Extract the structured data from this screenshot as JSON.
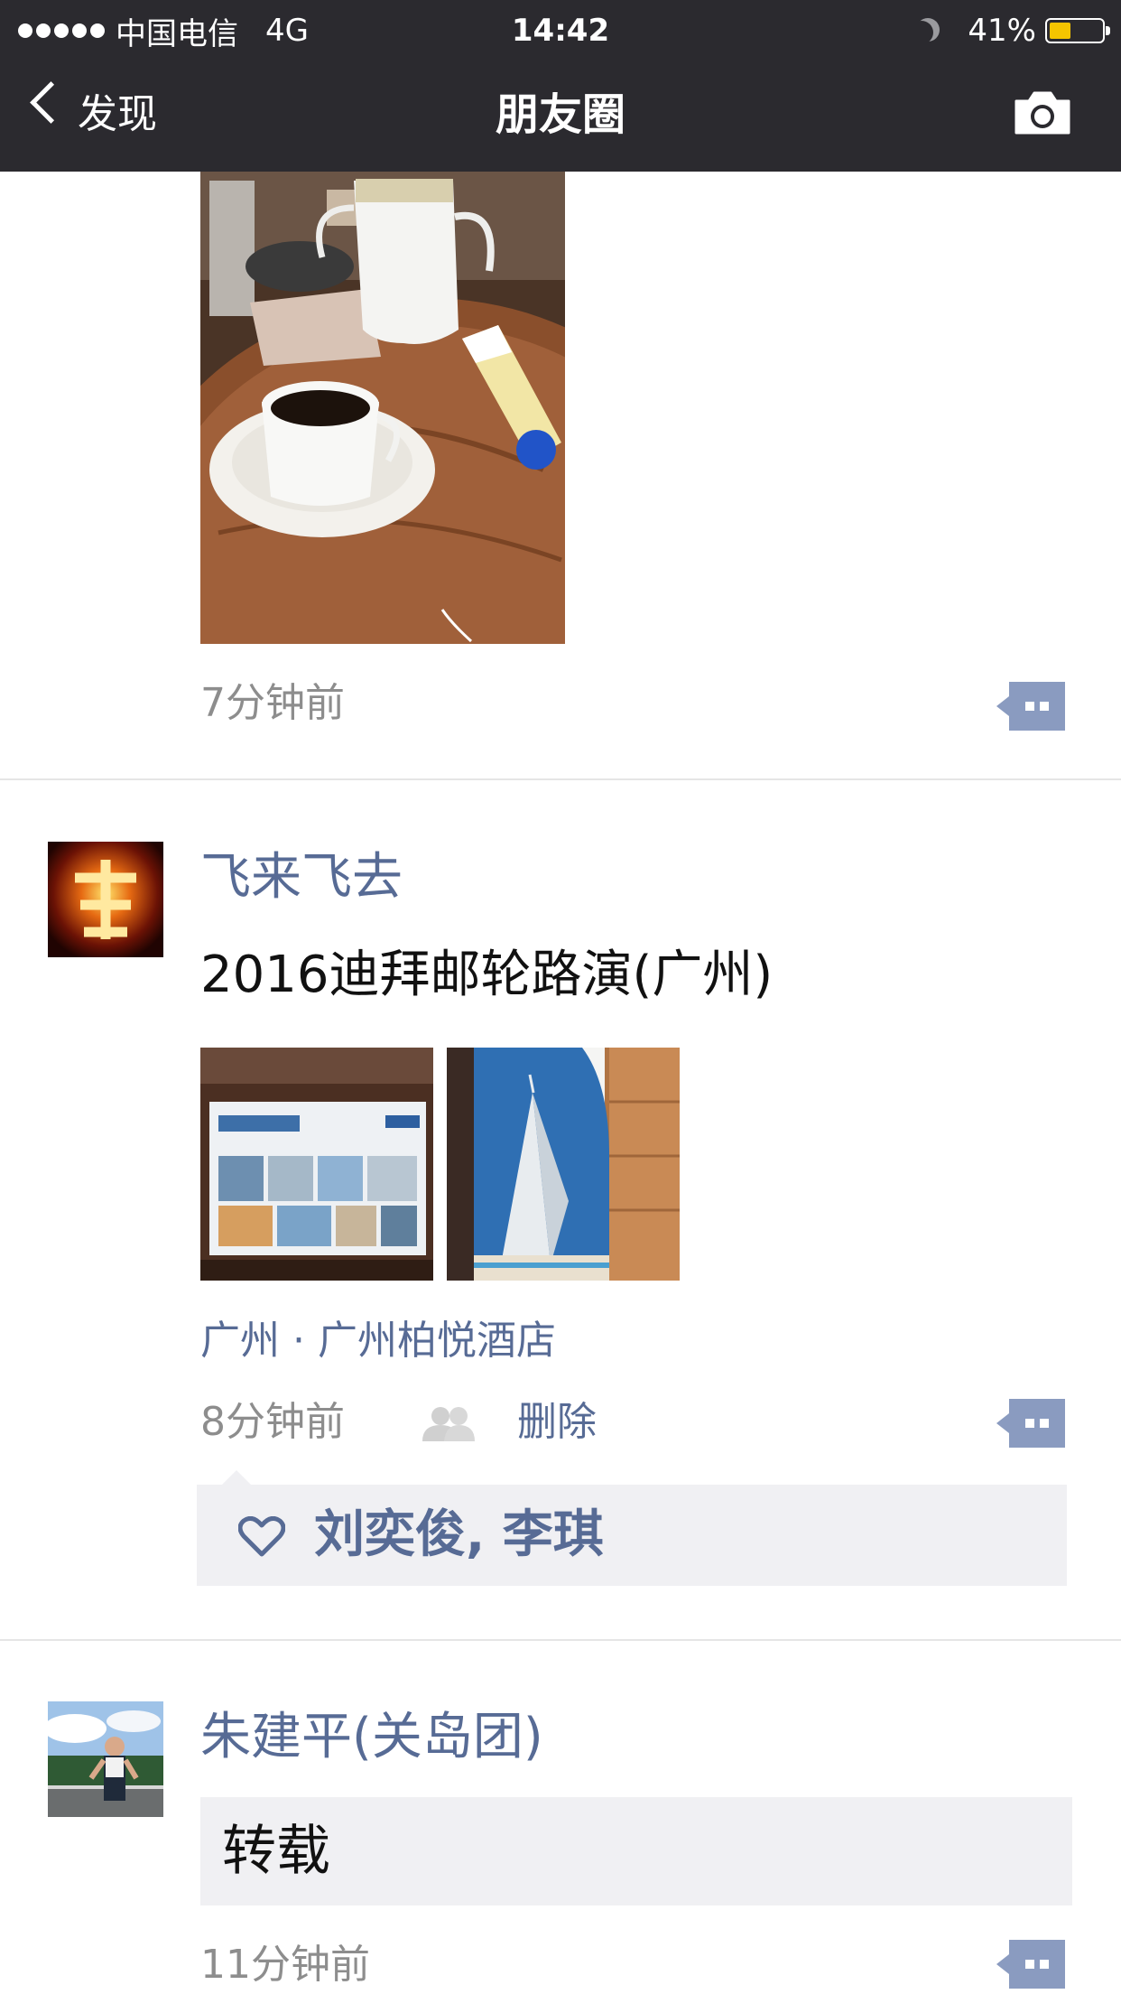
{
  "status_bar": {
    "carrier": "中国电信",
    "network": "4G",
    "time": "14:42",
    "battery": "41%",
    "battery_level": 0.41
  },
  "nav": {
    "back_label": "发现",
    "title": "朋友圈",
    "camera_icon": "camera-icon"
  },
  "feed": [
    {
      "time": "7分钟前"
    },
    {
      "username": "飞来飞去",
      "text": "2016迪拜邮轮路演(广州)",
      "location": "广州 · 广州柏悦酒店",
      "time": "8分钟前",
      "delete": "删除",
      "likes": "刘奕俊, 李琪"
    },
    {
      "username": "朱建平(关岛团)",
      "shared_text": "转载",
      "time": "11分钟前"
    }
  ],
  "colors": {
    "nav_bg": "#2b2a2f",
    "link": "#576b95",
    "meta": "#8d8d8d",
    "battery": "#f5c400"
  }
}
